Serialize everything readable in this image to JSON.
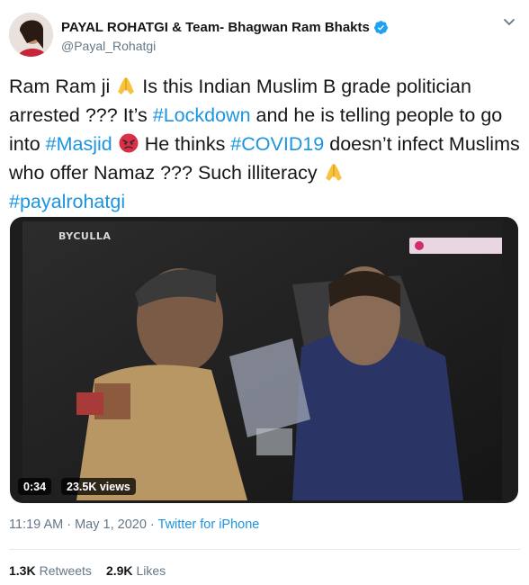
{
  "author": {
    "name": "PAYAL ROHATGI & Team- Bhagwan Ram Bhakts",
    "handle": "@Payal_Rohatgi",
    "verified_icon": "verified-badge-icon"
  },
  "tweet_text": {
    "p1": "Ram Ram ji",
    "p2": " Is this Indian Muslim B grade politician arrested ??? It’s ",
    "hashtag_lockdown": "#Lockdown",
    "p3": " and he is telling people to go into ",
    "hashtag_masjid": "#Masjid",
    "p4": " He thinks ",
    "hashtag_covid": "#COVID19",
    "p5": " doesn’t infect Muslims who offer Namaz ??? Such illiteracy ",
    "hashtag_payal": "#payalrohatgi"
  },
  "video": {
    "location_tag": "BYCULLA",
    "duration": "0:34",
    "views": "23.5K views"
  },
  "meta": {
    "time": "11:19 AM",
    "separator": " · ",
    "date": "May 1, 2020",
    "separator2": " · ",
    "source": "Twitter for iPhone"
  },
  "stats": {
    "retweets_count": "1.3K",
    "retweets_label": "Retweets",
    "likes_count": "2.9K",
    "likes_label": "Likes"
  },
  "colors": {
    "accent": "#1b95e0",
    "secondary_text": "#657786"
  }
}
